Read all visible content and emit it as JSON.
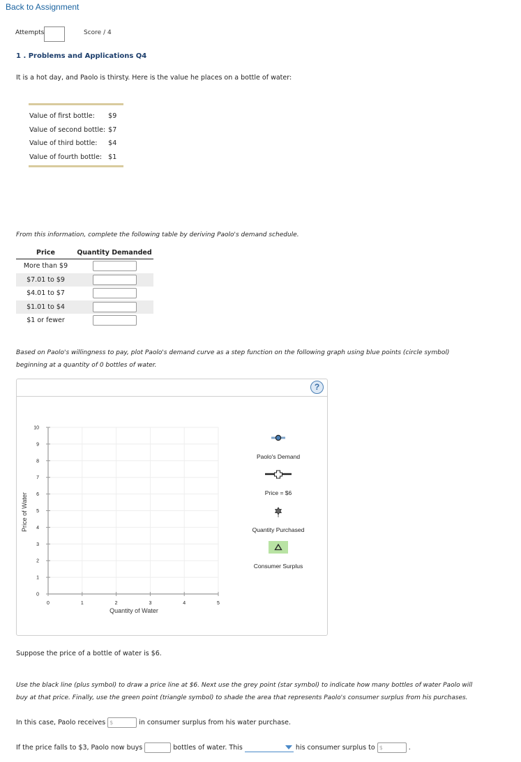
{
  "nav": {
    "back_label": "Back to Assignment"
  },
  "header": {
    "attempts_label": "Attempts",
    "attempts_value": "",
    "score_label": "Score / 4"
  },
  "question": {
    "title": "1 . Problems and Applications Q4",
    "intro": "It is a hot day, and Paolo is thirsty. Here is the value he places on a bottle of water:",
    "values": [
      {
        "label": "Value of first bottle:",
        "value": "$9"
      },
      {
        "label": "Value of second bottle:",
        "value": "$7"
      },
      {
        "label": "Value of third bottle:",
        "value": "$4"
      },
      {
        "label": "Value of fourth bottle:",
        "value": "$1"
      }
    ],
    "schedule_instruction": "From this information, complete the following table by deriving Paolo's demand schedule.",
    "schedule": {
      "headers": [
        "Price",
        "Quantity Demanded"
      ],
      "rows": [
        {
          "price": "More than $9",
          "qty": ""
        },
        {
          "price": "$7.01 to $9",
          "qty": ""
        },
        {
          "price": "$4.01 to $7",
          "qty": ""
        },
        {
          "price": "$1.01 to $4",
          "qty": ""
        },
        {
          "price": "$1 or fewer",
          "qty": ""
        }
      ]
    },
    "graph_instruction_1": "Based on Paolo's willingness to pay, plot Paolo's demand curve as a step function on the following graph using blue points (circle symbol)",
    "graph_instruction_2": "beginning at a quantity of 0 bottles of water.",
    "help_label": "?",
    "price_statement": "Suppose the price of a bottle of water is $6.",
    "tool_instruction_1": "Use the black line (plus symbol) to draw a price line at $6. Next use the grey point (star symbol) to indicate how many bottles of water Paolo will",
    "tool_instruction_2": "buy at that price. Finally, use the green point (triangle symbol) to shade the area that represents Paolo's consumer surplus from his purchases.",
    "cs_sentence": {
      "before": "In this case, Paolo receives",
      "input_placeholder": "$",
      "after": "in consumer surplus from his water purchase."
    },
    "fall_sentence": {
      "part1": "If the price falls to $3, Paolo now buys",
      "part2": "bottles of water. This",
      "dropdown_value": "",
      "part3": "his consumer surplus to",
      "input_placeholder": "$",
      "end": "."
    }
  },
  "chart_data": {
    "type": "scatter",
    "title": "",
    "xlabel": "Quantity of Water",
    "ylabel": "Price of Water",
    "xlim": [
      0,
      5
    ],
    "ylim": [
      0,
      10
    ],
    "x_ticks": [
      0,
      1,
      2,
      3,
      4,
      5
    ],
    "y_ticks": [
      0,
      1,
      2,
      3,
      4,
      5,
      6,
      7,
      8,
      9,
      10
    ],
    "grid": true,
    "series": [],
    "legend_position": "right",
    "legend": [
      {
        "name": "Paolo's Demand",
        "symbol": "circle",
        "color": "#4a7fb5"
      },
      {
        "name": "Price = $6",
        "symbol": "plus",
        "color": "#222222"
      },
      {
        "name": "Quantity Purchased",
        "symbol": "star",
        "color": "#666666"
      },
      {
        "name": "Consumer Surplus",
        "symbol": "triangle",
        "color": "#b9e3a4"
      }
    ]
  }
}
